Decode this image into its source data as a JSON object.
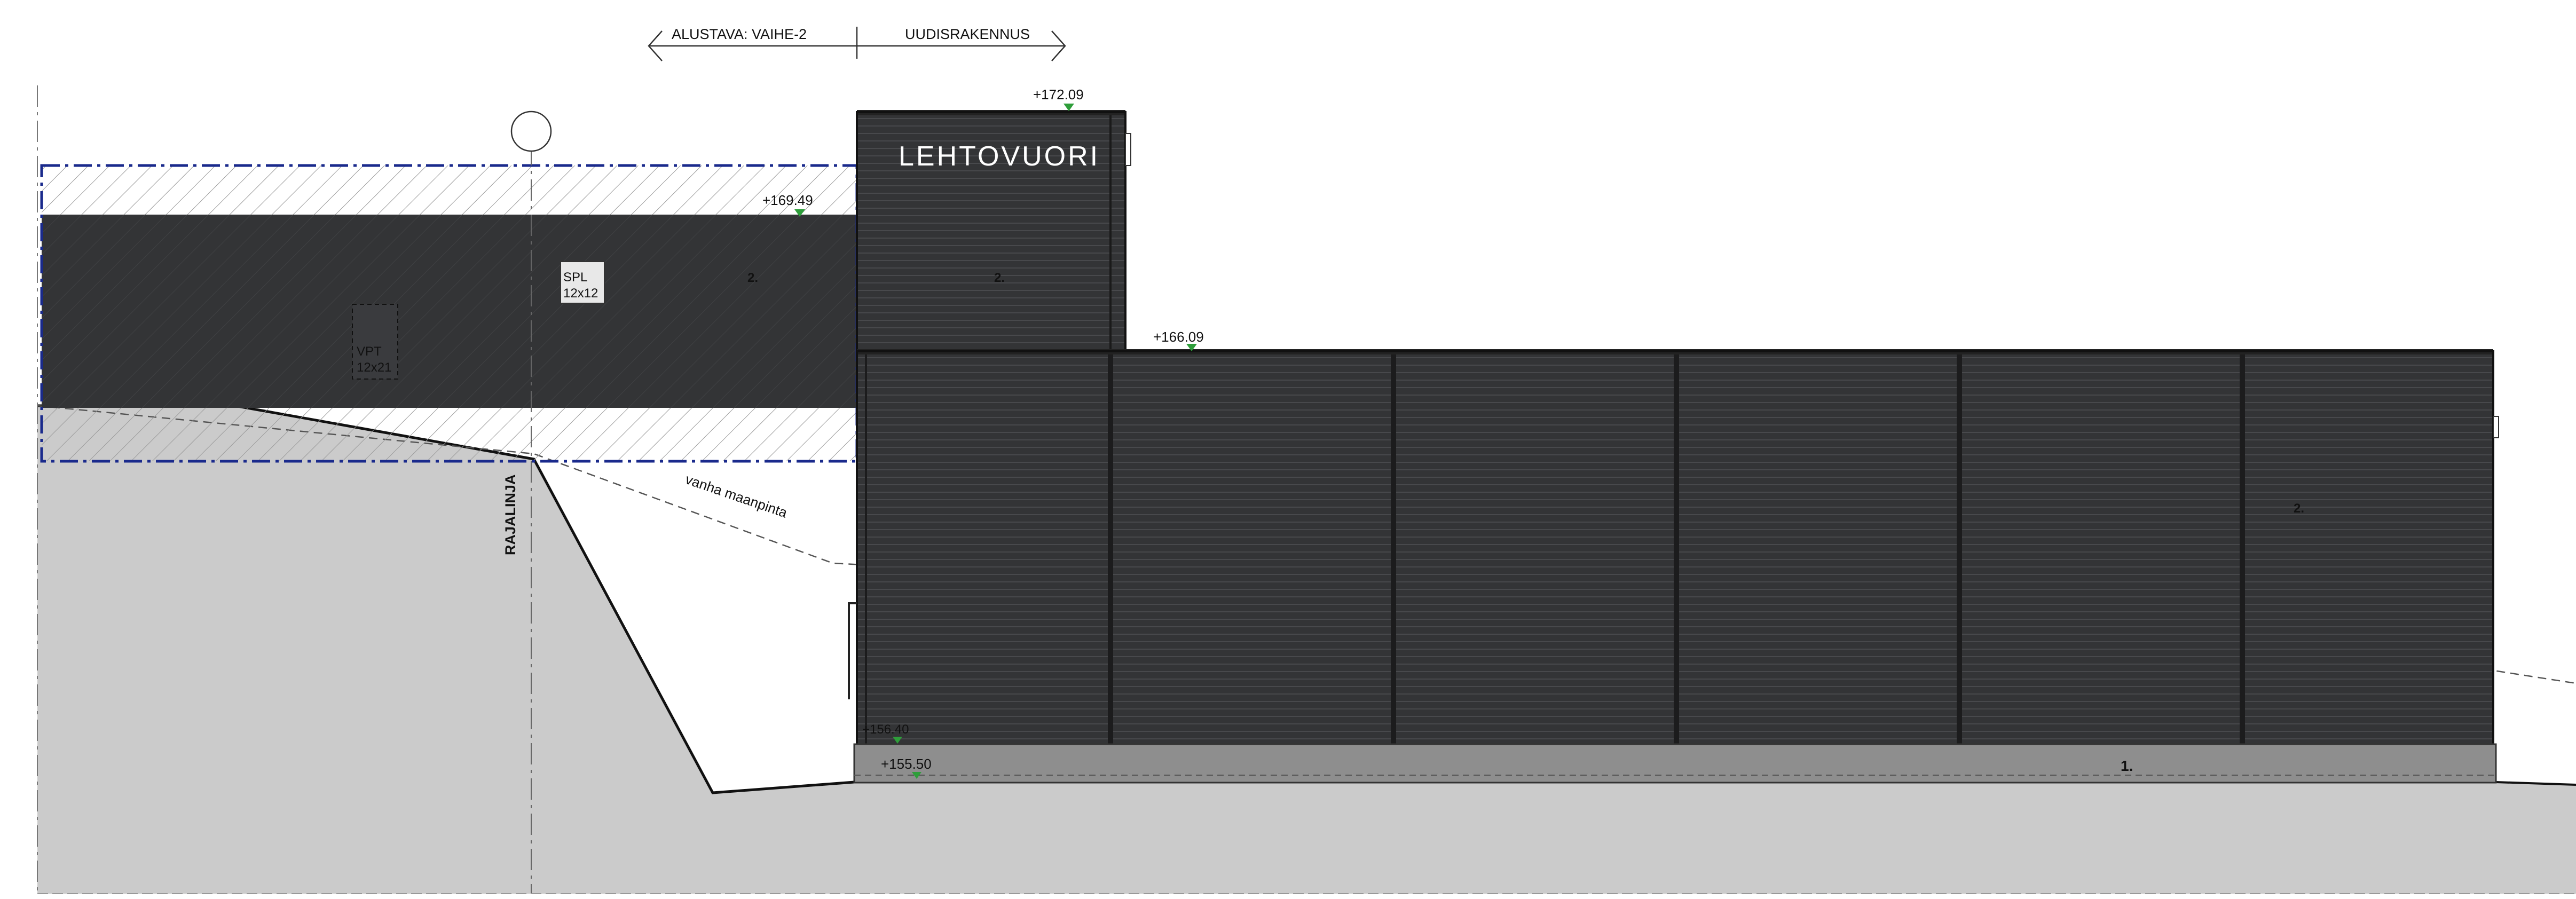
{
  "drawing": {
    "sign_text": "LEHTOVUORI",
    "phase_labels": {
      "left": "ALUSTAVA: VAIHE-2",
      "right": "UUDISRAKENNUS"
    },
    "boundary_label": "RAJALINJA",
    "old_ground_label": "vanha maanpinta",
    "openings": [
      {
        "name": "SPL",
        "size": "12x12"
      },
      {
        "name": "VPT",
        "size": "12x21"
      }
    ],
    "levels": [
      "+172.09",
      "+169.49",
      "+166.09",
      "+156.40",
      "+155.50"
    ],
    "zone_markers": [
      "2.",
      "2.",
      "2.",
      "1."
    ],
    "colors": {
      "cladding": "#333436",
      "cladding_line": "#47484b",
      "foundation": "#8e8e8e",
      "ground": "#cbcbcb",
      "phase_outline": "#1a2a8c",
      "level_marker": "#2e9e3a"
    }
  }
}
